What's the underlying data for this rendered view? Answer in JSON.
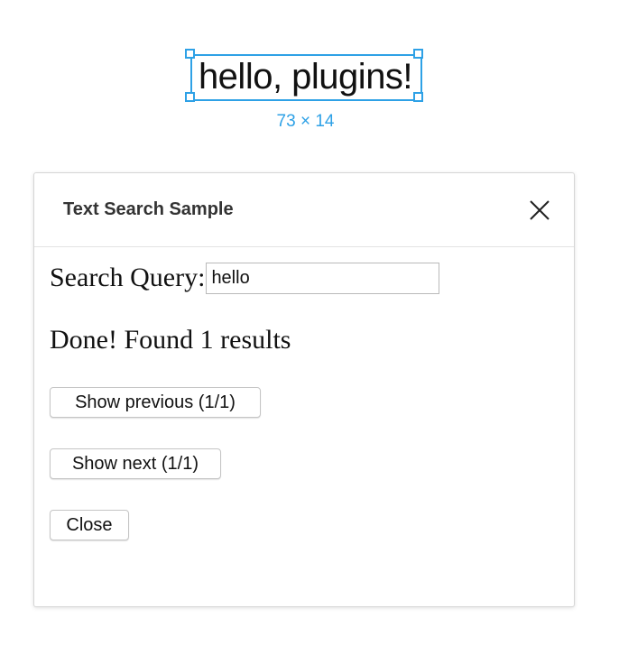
{
  "canvas": {
    "text_node": "hello, plugins!",
    "dimensions": "73 × 14",
    "selection_color": "#2ea1e6"
  },
  "panel": {
    "title": "Text Search Sample",
    "close_icon": "close-icon"
  },
  "search": {
    "label": "Search Query:",
    "value": "hello"
  },
  "status": {
    "message": "Done! Found 1 results"
  },
  "buttons": {
    "previous": "Show previous (1/1)",
    "next": "Show next (1/1)",
    "close": "Close"
  }
}
